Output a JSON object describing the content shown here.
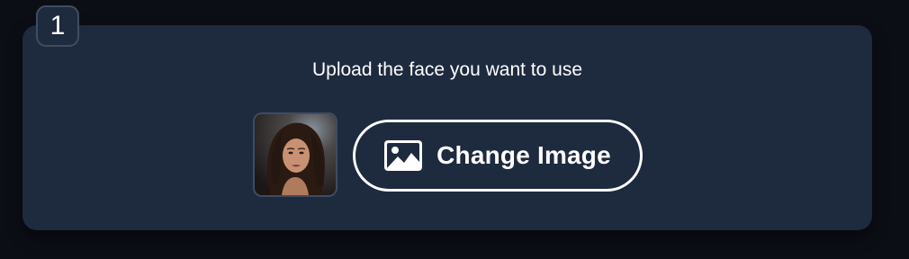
{
  "step": {
    "number": "1"
  },
  "upload": {
    "prompt": "Upload the face you want to use",
    "change_button_label": "Change Image",
    "button_icon": "image-icon",
    "thumbnail_alt": "Uploaded face preview"
  },
  "colors": {
    "page_background": "#0c0e16",
    "card_background": "#1e2a3e",
    "border": "#3f4c61",
    "text": "#ffffff"
  }
}
